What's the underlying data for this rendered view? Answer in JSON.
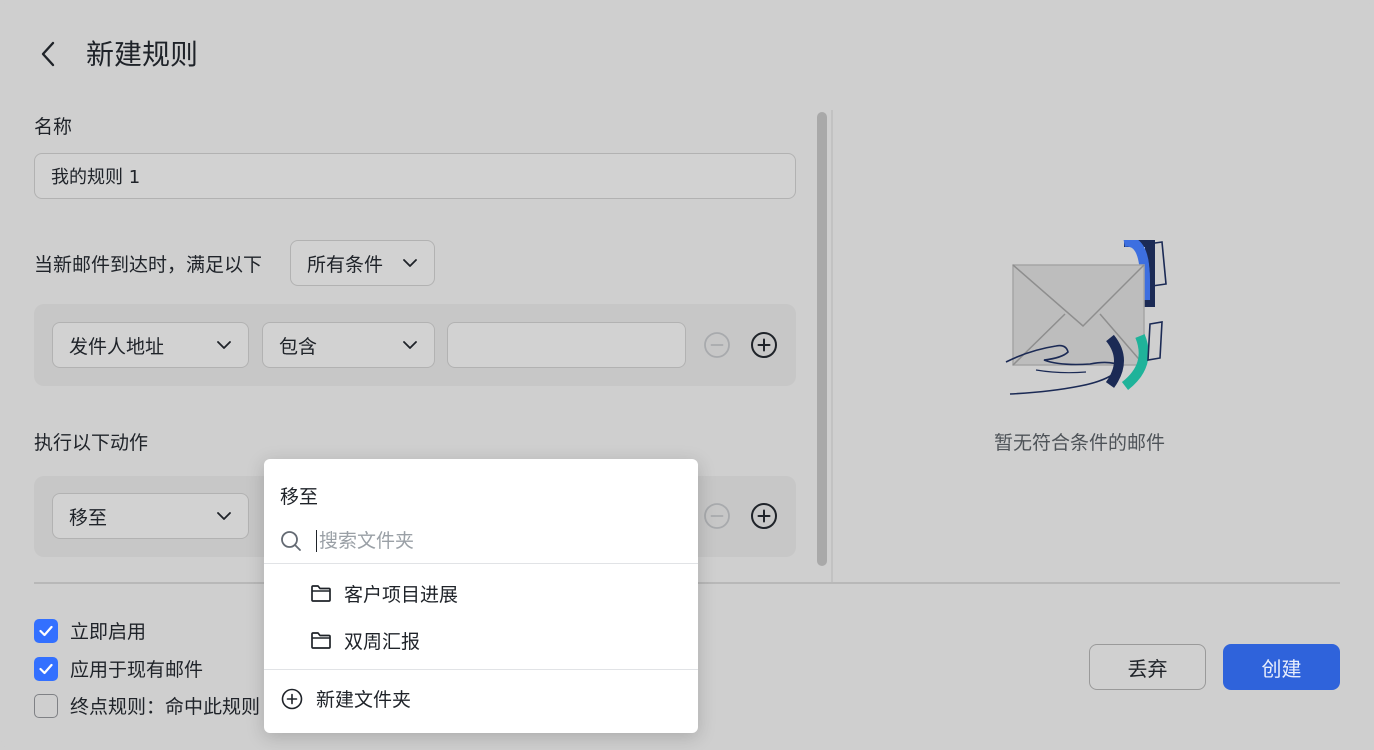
{
  "header": {
    "title": "新建规则"
  },
  "name_section": {
    "label": "名称",
    "value": "我的规则 1"
  },
  "conditions": {
    "intro": "当新邮件到达时，满足以下",
    "match_mode": "所有条件",
    "row": {
      "field": "发件人地址",
      "operator": "包含",
      "value": ""
    }
  },
  "actions": {
    "label": "执行以下动作",
    "row": {
      "action": "移至"
    }
  },
  "preview": {
    "empty_text": "暂无符合条件的邮件"
  },
  "options": [
    {
      "label": "立即启用",
      "checked": true
    },
    {
      "label": "应用于现有邮件",
      "checked": true
    },
    {
      "label": "终点规则：命中此规则",
      "checked": false
    }
  ],
  "footer": {
    "discard_label": "丢弃",
    "create_label": "创建"
  },
  "folder_popup": {
    "title": "移至",
    "search_placeholder": "搜索文件夹",
    "folders": [
      "客户项目进展",
      "双周汇报"
    ],
    "new_folder_label": "新建文件夹"
  },
  "colors": {
    "primary": "#2f63db",
    "checkbox": "#3370ff",
    "illustration_blue": "#3d6fe0",
    "illustration_teal": "#1fb39a"
  }
}
